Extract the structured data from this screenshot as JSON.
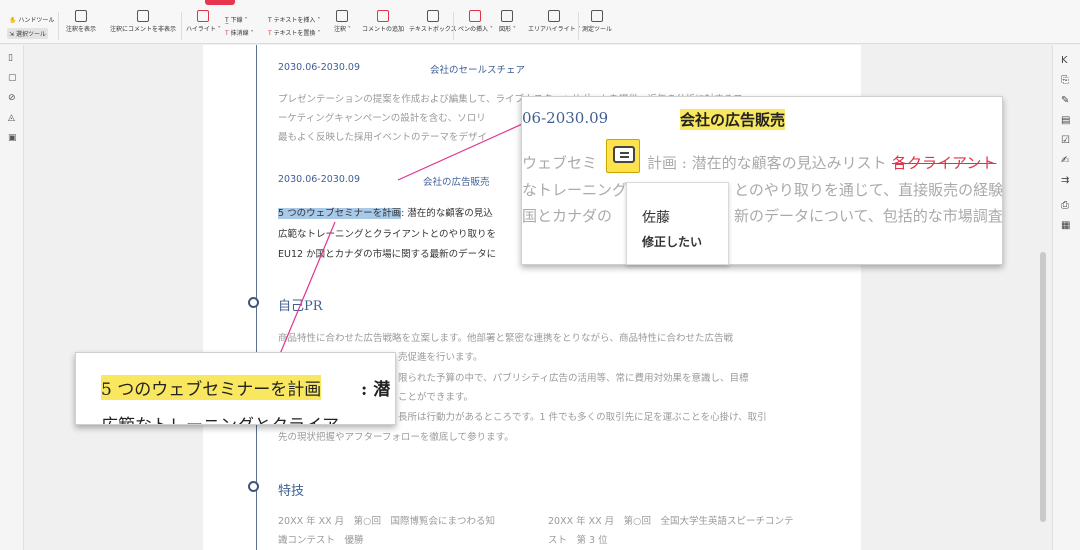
{
  "toolbar": {
    "hand_tool": "ハンドツール",
    "select_tool": "選択ツール",
    "show_notes": "注釈を表示",
    "hide_notes": "注釈にコメントを非表示",
    "highlight": "ハイライト",
    "underline": "下線",
    "strikethrough": "抹消線",
    "insert_text": "テキストを挿入",
    "replace_text": "テキストを置換",
    "note": "注釈",
    "add_comment": "コメントの追加",
    "textbox": "テキストボックス",
    "pen": "ペンの挿入",
    "shape": "図形",
    "area_highlight": "エリアハイライト",
    "measure": "測定ツール"
  },
  "doc": {
    "section1_date": "2030.06-2030.09",
    "section1_title": "会社のセールスチェア",
    "section1_body": [
      "プレゼンテーションの提案を作成および編集して、ライブカスターへサポートを提供。近年の分析に対するフ",
      "ーケティングキャンペーンの設計を含む、ソロリ",
      "最もよく反映した採用イベントのテーマをデザイ"
    ],
    "section2_date": "2030.06-2030.09",
    "section2_title": "会社の広告販売",
    "section2_highlight": "5 つのウェブセミナーを計画",
    "section2_line1_rest": ": 潜在的な顧客の見込",
    "section2_line2": "広範なトレーニングとクライアントとのやり取りを",
    "section2_line3": "EU12 か国とカナダの市場に関する最新のデータに",
    "self_pr_heading": "自己PR",
    "self_pr_body": [
      "商品特性に合わせた広告戦略を立案します。他部署と緊密な連携をとりながら、商品特性に合わせた広告戦",
      "売促進を行います。",
      "限られた予算の中で、パブリシティ広告の活用等、常に費用対効果を意識し、目標",
      "ことができます。",
      "長所は行動力があるところです。1 件でも多くの取引先に足を運ぶことを心掛け、取引",
      "先の現状把握やアフターフォローを徹底して参ります。"
    ],
    "skills_heading": "特技",
    "skills_left": [
      "20XX 年 XX 月　第○回　国際博覧会にまつわる知",
      "識コンテスト　優勝"
    ],
    "skills_right": [
      "20XX 年 XX 月　第○回　全国大学生英語スピーチコンテ",
      "スト　第 3 位"
    ]
  },
  "zoom_top": {
    "date": "06-2030.09",
    "title": "会社の広告販売",
    "line1_a": "ウェブセミ",
    "line1_b": "計画 : 潜在的な顧客の見込みリスト",
    "line1_strike": "各クライアント",
    "line2_a": "なトレーニング",
    "line2_b": "とのやり取りを通じて、直接販売の経験",
    "line3_a": "国とカナダの",
    "line3_b": "新のデータについて、包括的な市場調査と",
    "note_author": "佐藤",
    "note_text": "修正したい"
  },
  "zoom_bottom": {
    "highlight": "5 つのウェブセミナーを計画",
    "after": " : 潜",
    "line2": "広範なトレーニングとクライア"
  },
  "colors": {
    "accent": "#e0344c",
    "heading_blue": "#3f5f93",
    "highlight_yellow": "#f9e85f",
    "highlight_blue": "#a8c9e8",
    "callout_line": "#e2338f"
  }
}
